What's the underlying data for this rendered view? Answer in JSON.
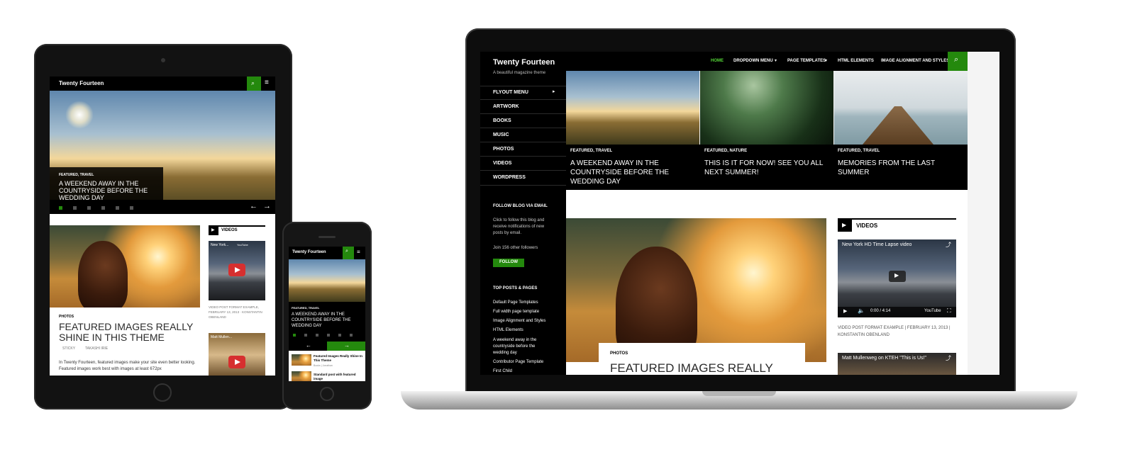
{
  "site": {
    "title": "Twenty Fourteen",
    "tagline": "A beautiful magazine theme"
  },
  "nav": {
    "items": [
      "HOME",
      "DROPDOWN MENU",
      "PAGE TEMPLATES",
      "HTML ELEMENTS",
      "IMAGE ALIGNMENT AND STYLES"
    ],
    "active_color": "#24890d"
  },
  "sidebar": {
    "menu": [
      "FLYOUT MENU",
      "ARTWORK",
      "BOOKS",
      "MUSIC",
      "PHOTOS",
      "VIDEOS",
      "WORDPRESS"
    ],
    "follow_heading": "FOLLOW BLOG VIA EMAIL",
    "follow_text": "Click to follow this blog and receive notifications of new posts by email.",
    "join_text": "Join 156 other followers",
    "follow_button": "FOLLOW",
    "top_heading": "TOP POSTS & PAGES",
    "top_links": [
      "Default Page Templates",
      "Full width page template",
      "Image Alignment and Styles",
      "HTML Elements",
      "A weekend away in the countryside before the wedding day",
      "Contributor Page Template",
      "First Child"
    ]
  },
  "featured": [
    {
      "cats": "FEATURED, TRAVEL",
      "title": "A WEEKEND AWAY IN THE COUNTRYSIDE BEFORE THE WEDDING DAY"
    },
    {
      "cats": "FEATURED, NATURE",
      "title": "THIS IS IT FOR NOW! SEE YOU ALL NEXT SUMMER!"
    },
    {
      "cats": "FEATURED, TRAVEL",
      "title": "MEMORIES FROM THE LAST SUMMER"
    }
  ],
  "post": {
    "cat": "PHOTOS",
    "title": "FEATURED IMAGES REALLY SHINE IN THIS THEME",
    "title_laptop": "FEATURED IMAGES REALLY",
    "meta_sticky": "STICKY",
    "meta_author": "TAKASHI IRIE",
    "excerpt": "In Twenty Fourteen, featured images make your site even better looking. Featured images work best with images at least 672px"
  },
  "videos": {
    "heading": "VIDEOS",
    "items": [
      {
        "title": "New York HD Time Lapse video",
        "time": "0:00 / 4:14",
        "tablet_title": "New York..."
      },
      {
        "title": "Matt Mullenweg on KTEH \"This is Us!\"",
        "tablet_title": "Matt Mullen..."
      }
    ],
    "caption_laptop": "VIDEO POST FORMAT EXAMPLE | FEBRUARY 13, 2013 | KONSTANTIN OBENLAND",
    "caption_tablet": "VIDEO POST FORMAT EXAMPLE, FEBRUARY 13, 2013 · KONSTANTIN OBENLAND",
    "youtube": "YouTube"
  },
  "phone": {
    "list": [
      {
        "title": "Featured Images Really Shine In This Theme",
        "meta": "Books | Jonathan"
      },
      {
        "title": "Standard post with featured image"
      }
    ]
  },
  "colors": {
    "accent": "#24890d",
    "dark": "#000000",
    "panel": "#111111"
  }
}
